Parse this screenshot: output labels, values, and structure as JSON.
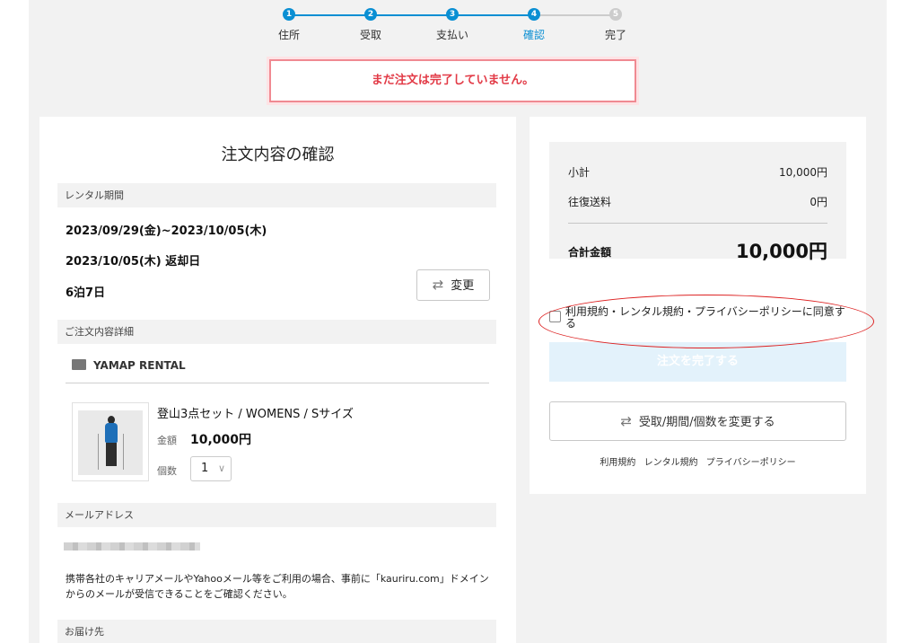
{
  "stepper": {
    "steps": [
      {
        "num": "1",
        "label": "住所"
      },
      {
        "num": "2",
        "label": "受取"
      },
      {
        "num": "3",
        "label": "支払い"
      },
      {
        "num": "4",
        "label": "確認"
      },
      {
        "num": "5",
        "label": "完了"
      }
    ],
    "active_index": 4,
    "colors": {
      "done": "#0a8fd3",
      "pending": "#cccccc"
    }
  },
  "alert": {
    "message": "まだ注文は完了していません。"
  },
  "order": {
    "title": "注文内容の確認",
    "rental_period": {
      "heading": "レンタル期間",
      "range": "2023/09/29(金)~2023/10/05(木)",
      "return_date": "2023/10/05(木) 返却日",
      "duration": "6泊7日",
      "change_label": "変更"
    },
    "details": {
      "heading": "ご注文内容詳細",
      "shop_name": "YAMAP RENTAL",
      "product_name": "登山3点セット / WOMENS / Sサイズ",
      "price_label": "金額",
      "price": "10,000円",
      "qty_label": "個数",
      "qty": "1"
    },
    "email": {
      "heading": "メールアドレス",
      "note": "携帯各社のキャリアメールやYahooメール等をご利用の場合、事前に「kauriru.com」ドメインからのメールが受信できることをご確認ください。"
    },
    "delivery": {
      "heading": "お届け先"
    }
  },
  "summary": {
    "subtotal_label": "小計",
    "subtotal": "10,000円",
    "shipping_label": "往復送料",
    "shipping": "0円",
    "total_label": "合計金額",
    "total": "10,000円",
    "agree_label": "利用規約・レンタル規約・プライバシーポリシーに同意する",
    "complete_label": "注文を完了する",
    "modify_label": "受取/期間/個数を変更する",
    "links": [
      "利用規約",
      "レンタル規約",
      "プライバシーポリシー"
    ]
  }
}
